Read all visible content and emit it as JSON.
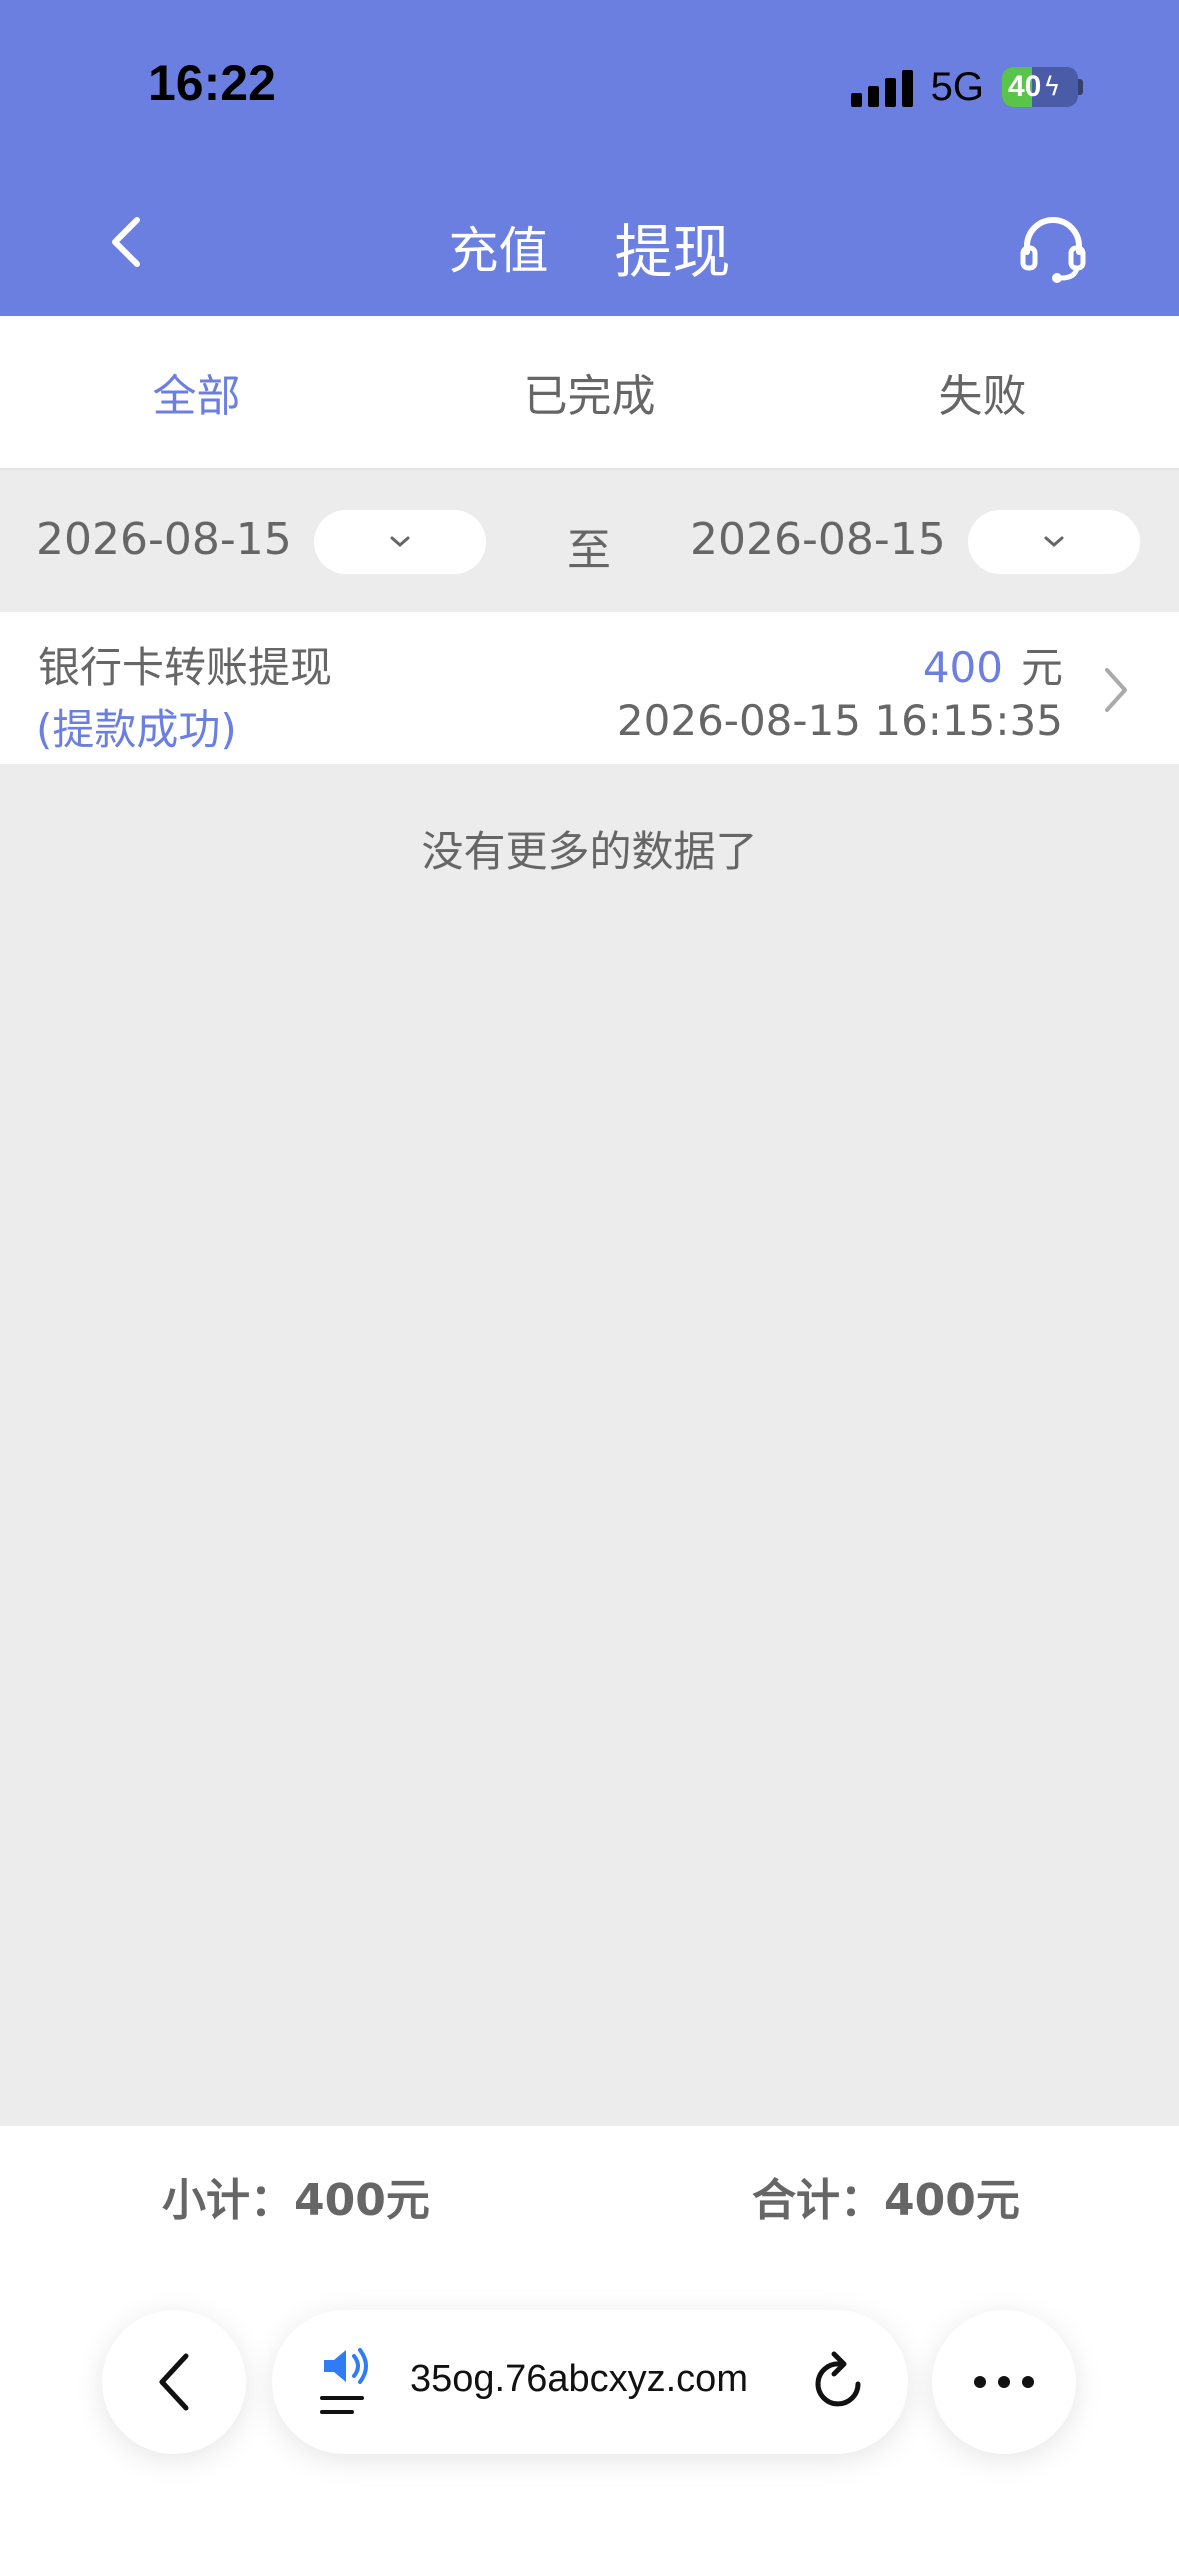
{
  "status_bar": {
    "time": "16:22",
    "network": "5G",
    "battery": "40"
  },
  "nav": {
    "tabs": [
      "充值",
      "提现"
    ],
    "active_tab": 1
  },
  "filter_tabs": {
    "items": [
      "全部",
      "已完成",
      "失败"
    ],
    "active": 0
  },
  "date_filter": {
    "start": "2026-08-15",
    "end": "2026-08-15",
    "separator": "至"
  },
  "records": [
    {
      "title": "银行卡转账提现",
      "status": "(提款成功)",
      "amount": "400",
      "unit": "元",
      "time": "2026-08-15 16:15:35"
    }
  ],
  "no_more_text": "没有更多的数据了",
  "summary": {
    "subtotal": "小计：400元",
    "total": "合计：400元"
  },
  "browser": {
    "url": "35og.76abcxyz.com"
  },
  "colors": {
    "accent": "#6b7fe0",
    "background": "#ececec"
  }
}
